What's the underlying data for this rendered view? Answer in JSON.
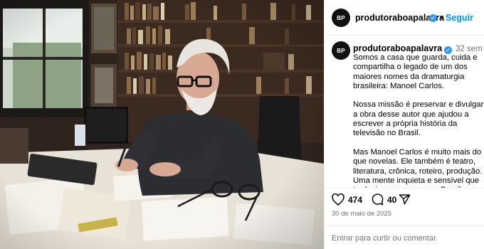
{
  "account": {
    "avatar_text": "BP",
    "username": "produtoraboapalavra",
    "follow_label": "Seguir",
    "separator": "•",
    "more_icon": "···"
  },
  "caption": {
    "age": "32 sem",
    "paragraphs": [
      "Somos a casa que guarda, cuida e compartilha o legado de um dos maiores nomes da dramaturgia brasileira: Manoel Carlos.",
      "Nossa missão é preservar e divulgar a obra desse autor que ajudou a escrever a própria história da televisão no Brasil.",
      "Mas Manoel Carlos é muito mais do que novelas. Ele também é teatro, literatura, crônica, roteiro, produção. Uma mente inquieta e sensível que traduziu como poucos o Brasil, os"
    ]
  },
  "actions": {
    "likes": "474",
    "comments": "40",
    "date": "30 de maio de 2025"
  },
  "login_prompt": {
    "link": "Entrar",
    "text": " para curtir ou comentar."
  },
  "colors": {
    "accent": "#0095f6",
    "verified": "#3897f0",
    "muted": "#737373"
  },
  "icons": [
    "verified-badge-icon",
    "heart-icon",
    "comment-icon",
    "share-icon",
    "more-options-icon"
  ]
}
